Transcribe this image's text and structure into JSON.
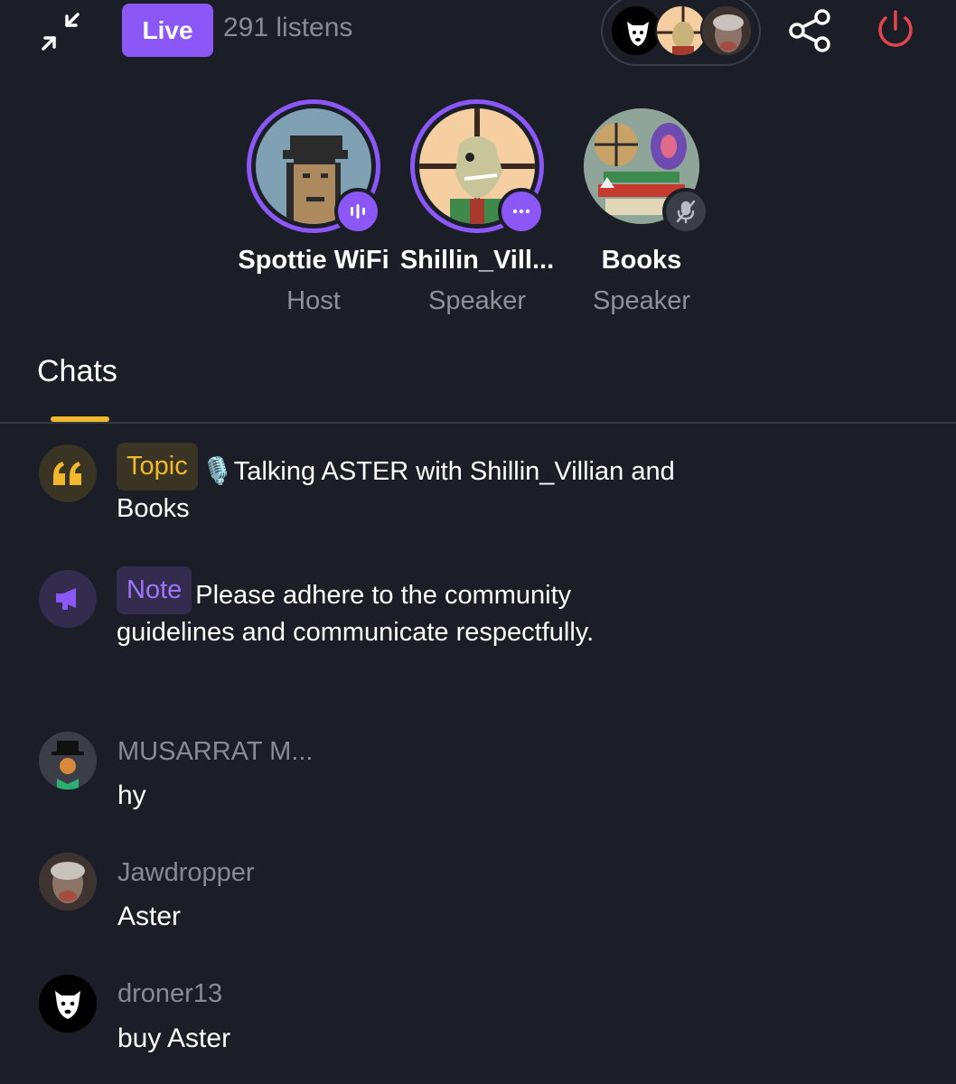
{
  "header": {
    "live_label": "Live",
    "listen_count": "291 listens"
  },
  "speakers": [
    {
      "name": "Spottie WiFi",
      "role": "Host",
      "badge": "speaking-icon"
    },
    {
      "name": "Shillin_Vill...",
      "role": "Speaker",
      "badge": "more-icon"
    },
    {
      "name": "Books",
      "role": "Speaker",
      "badge": "mic-off-icon"
    }
  ],
  "tabs": {
    "chats": "Chats"
  },
  "pinned": {
    "topic_label": "Topic",
    "topic_text": "🎙️Talking ASTER with Shillin_Villian and Books",
    "note_label": "Note",
    "note_text": "Please adhere to the community guidelines and communicate respectfully."
  },
  "messages": [
    {
      "user": "MUSARRAT M...",
      "text": "hy"
    },
    {
      "user": "Jawdropper",
      "text": "Aster"
    },
    {
      "user": "droner13",
      "text": "buy Aster"
    }
  ],
  "colors": {
    "background": "#1b1e26",
    "accent": "#8b57f7",
    "topic": "#f1b82c",
    "leave": "#e6454f",
    "muted_text": "#878b96"
  }
}
